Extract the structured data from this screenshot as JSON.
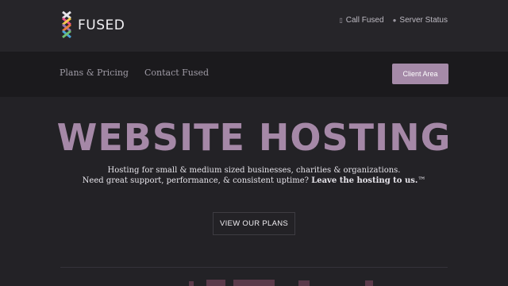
{
  "brand": {
    "name": "FUSED"
  },
  "top_links": [
    {
      "icon": "phone-icon",
      "label": "Call Fused"
    },
    {
      "icon": "user-icon",
      "label": "Server Status"
    }
  ],
  "nav": {
    "items": [
      {
        "label": "Plans & Pricing"
      },
      {
        "label": "Contact Fused"
      }
    ],
    "client_button": "Client Area"
  },
  "hero": {
    "title": "WEBSITE HOSTING",
    "line1": "Hosting for small & medium sized businesses, charities & organizations.",
    "line2_prefix": "Need great support, performance, & consistent uptime?",
    "line2_bold": "Leave the hosting to us.",
    "line2_suffix": "™",
    "cta": "VIEW OUR PLANS"
  },
  "colors": {
    "accent": "#a588a7",
    "background": "#232226",
    "navbar": "#1b1a1d"
  }
}
